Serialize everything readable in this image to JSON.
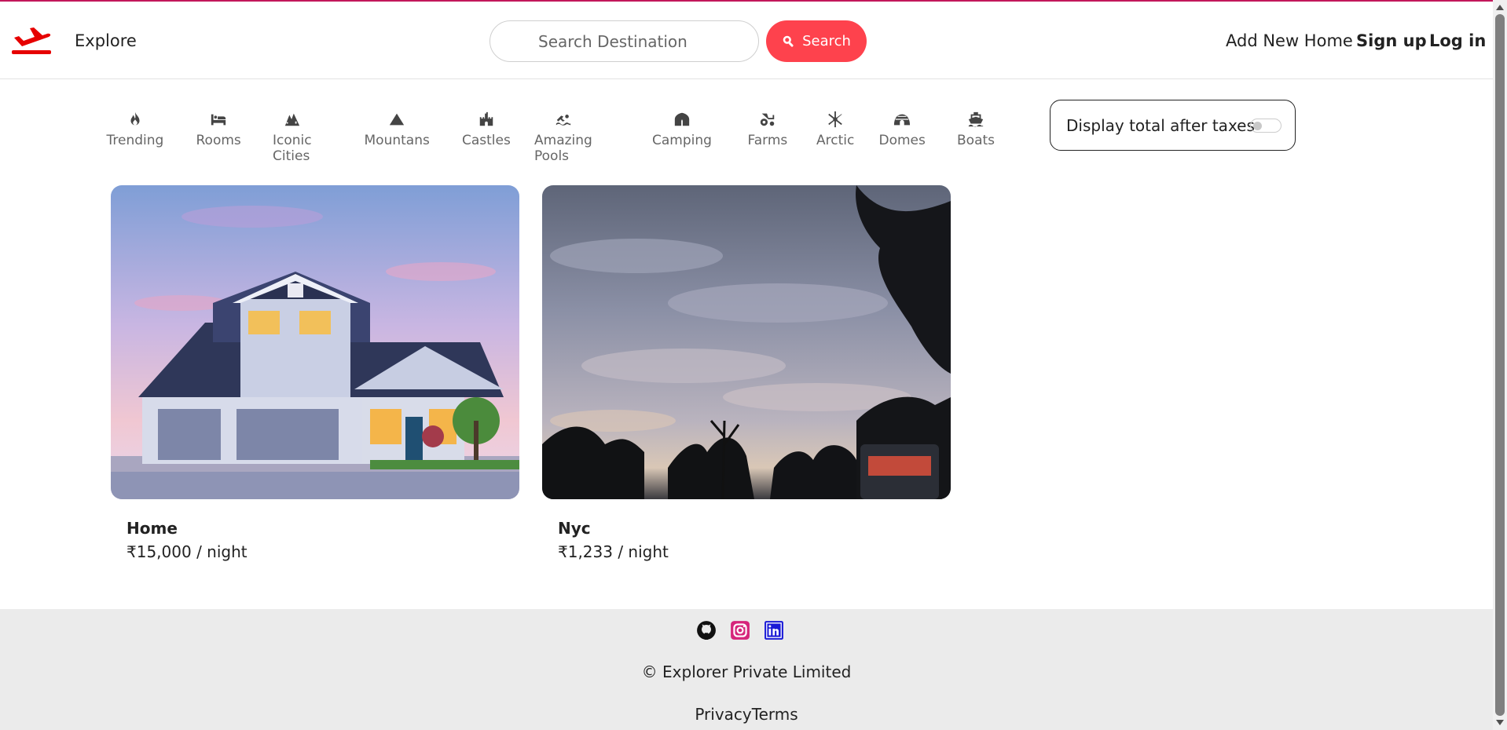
{
  "navbar": {
    "logo_icon": "plane-icon",
    "brand": "Explore",
    "search_placeholder": "Search Destination",
    "search_button": "Search",
    "add_home": "Add New Home",
    "signup": "Sign up",
    "login": "Log in"
  },
  "filters": [
    {
      "label": "Trending",
      "icon": "fire-icon"
    },
    {
      "label": "Rooms",
      "icon": "bed-icon"
    },
    {
      "label": "Iconic Cities",
      "icon": "city-icon"
    },
    {
      "label": "Mountans",
      "icon": "mountain-icon"
    },
    {
      "label": "Castles",
      "icon": "castle-icon"
    },
    {
      "label": "Amazing Pools",
      "icon": "swimmer-icon"
    },
    {
      "label": "Camping",
      "icon": "tent-icon"
    },
    {
      "label": "Farms",
      "icon": "tractor-icon"
    },
    {
      "label": "Arctic",
      "icon": "snowflake-icon"
    },
    {
      "label": "Domes",
      "icon": "igloo-icon"
    },
    {
      "label": "Boats",
      "icon": "ship-icon"
    }
  ],
  "tax_toggle": {
    "label": "Display total after taxes",
    "enabled": false
  },
  "listings": [
    {
      "title": "Home",
      "price": "₹15,000 / night"
    },
    {
      "title": "Nyc",
      "price": "₹1,233 / night"
    }
  ],
  "footer": {
    "socials": [
      "github-icon",
      "instagram-icon",
      "linkedin-icon"
    ],
    "copyright": "© Explorer Private Limited",
    "links": "PrivacyTerms"
  },
  "colors": {
    "accent": "#fe424d",
    "logo": "#e60000",
    "topline": "#c2185b",
    "footer_bg": "#ebebeb"
  }
}
